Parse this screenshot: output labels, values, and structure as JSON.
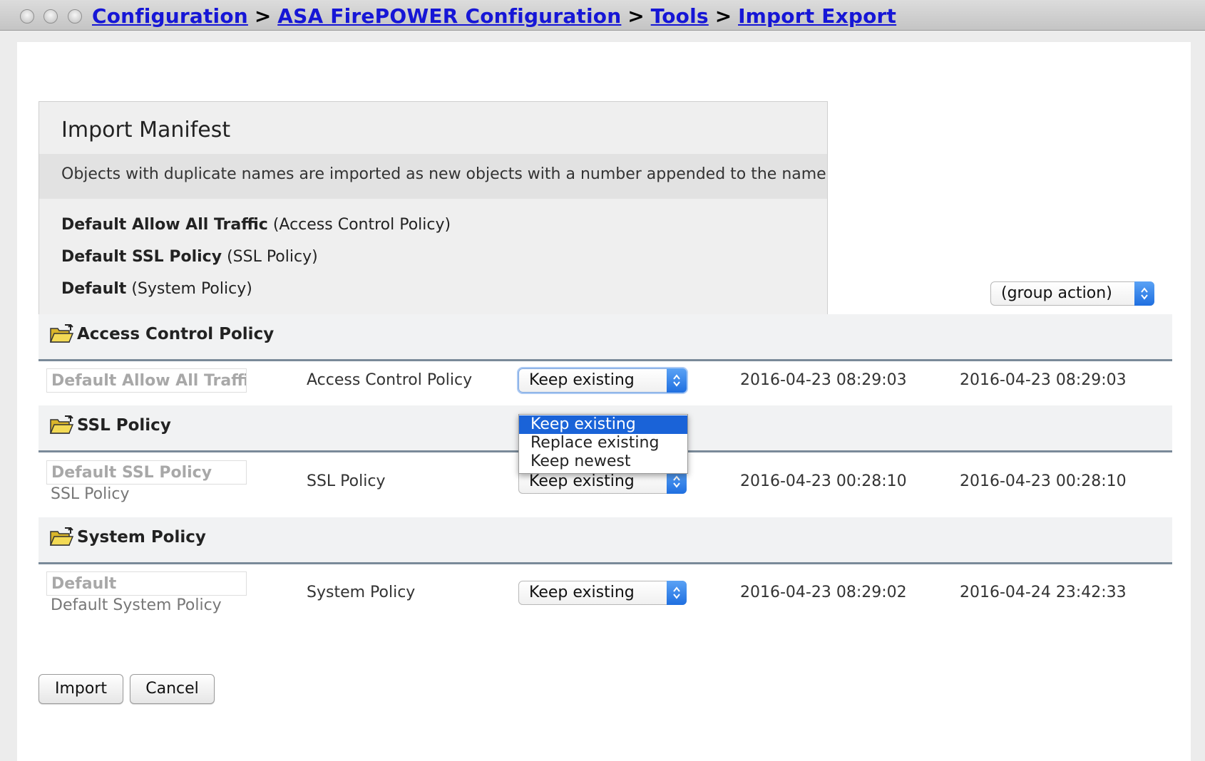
{
  "breadcrumb": {
    "items": [
      "Configuration",
      "ASA FirePOWER Configuration",
      "Tools",
      "Import Export"
    ],
    "separator": ">"
  },
  "manifest": {
    "title": "Import Manifest",
    "note": "Objects with duplicate names are imported as new objects with a number appended to the name",
    "items": [
      {
        "name": "Default Allow All Traffic",
        "type": "(Access Control Policy)"
      },
      {
        "name": "Default SSL Policy",
        "type": "(SSL Policy)"
      },
      {
        "name": "Default",
        "type": "(System Policy)"
      }
    ]
  },
  "group_action": {
    "value": "(group action)"
  },
  "sections": [
    {
      "title": "Access Control Policy",
      "row": {
        "name": "Default Allow All Traffic",
        "subname": "",
        "type": "Access Control Policy",
        "action": "Keep existing",
        "date1": "2016-04-23 08:29:03",
        "date2": "2016-04-23 08:29:03"
      }
    },
    {
      "title": "SSL Policy",
      "row": {
        "name": "Default SSL Policy",
        "subname": "SSL Policy",
        "type": "SSL Policy",
        "action": "Keep existing",
        "date1": "2016-04-23 00:28:10",
        "date2": "2016-04-23 00:28:10"
      }
    },
    {
      "title": "System Policy",
      "row": {
        "name": "Default",
        "subname": "Default System Policy",
        "type": "System Policy",
        "action": "Keep existing",
        "date1": "2016-04-23 08:29:02",
        "date2": "2016-04-24 23:42:33"
      }
    }
  ],
  "dropdown": {
    "options": [
      "Keep existing",
      "Replace existing",
      "Keep newest"
    ],
    "selected": "Keep existing"
  },
  "buttons": {
    "import": "Import",
    "cancel": "Cancel"
  },
  "colors": {
    "link": "#1616d6",
    "select_arrow": "#1f6fe0",
    "dropdown_highlight": "#1a63d8",
    "section_rule": "#7a8a99"
  }
}
